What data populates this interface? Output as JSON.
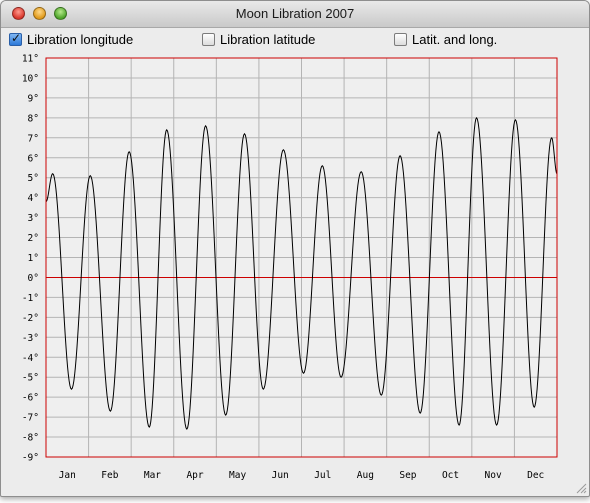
{
  "window": {
    "title": "Moon Libration 2007"
  },
  "checkboxes": [
    {
      "label": "Libration longitude",
      "checked": true
    },
    {
      "label": "Libration latitude",
      "checked": false
    },
    {
      "label": "Latit. and long.",
      "checked": false
    }
  ],
  "chart_data": {
    "type": "line",
    "ylim": [
      -9,
      11
    ],
    "yticks": [
      "11°",
      "10°",
      "9°",
      "8°",
      "7°",
      "6°",
      "5°",
      "4°",
      "3°",
      "2°",
      "1°",
      "0°",
      "-1°",
      "-2°",
      "-3°",
      "-4°",
      "-5°",
      "-6°",
      "-7°",
      "-8°",
      "-9°"
    ],
    "months": [
      "Jan",
      "Feb",
      "Mar",
      "Apr",
      "May",
      "Jun",
      "Jul",
      "Aug",
      "Sep",
      "Oct",
      "Nov",
      "Dec"
    ],
    "grid": true,
    "zero_line": true,
    "colors": {
      "frame": "#cc0000",
      "zero": "#cc0000",
      "grid": "#b4b4b4",
      "line": "#000000"
    },
    "series": [
      {
        "extrema": [
          {
            "day": 0,
            "value": 3.8
          },
          {
            "day": 5,
            "value": 5.2
          },
          {
            "day": 19,
            "value": -5.6
          },
          {
            "day": 33,
            "value": 5.1
          },
          {
            "day": 48,
            "value": -6.7
          },
          {
            "day": 62,
            "value": 6.3
          },
          {
            "day": 77,
            "value": -7.5
          },
          {
            "day": 90,
            "value": 7.4
          },
          {
            "day": 105,
            "value": -7.6
          },
          {
            "day": 119,
            "value": 7.6
          },
          {
            "day": 134,
            "value": -6.9
          },
          {
            "day": 148,
            "value": 7.2
          },
          {
            "day": 162,
            "value": -5.6
          },
          {
            "day": 177,
            "value": 6.4
          },
          {
            "day": 192,
            "value": -4.8
          },
          {
            "day": 206,
            "value": 5.6
          },
          {
            "day": 220,
            "value": -5.0
          },
          {
            "day": 235,
            "value": 5.3
          },
          {
            "day": 250,
            "value": -5.9
          },
          {
            "day": 264,
            "value": 6.1
          },
          {
            "day": 279,
            "value": -6.8
          },
          {
            "day": 293,
            "value": 7.3
          },
          {
            "day": 308,
            "value": -7.4
          },
          {
            "day": 321,
            "value": 8.0
          },
          {
            "day": 336,
            "value": -7.4
          },
          {
            "day": 350,
            "value": 7.9
          },
          {
            "day": 364,
            "value": -6.5
          },
          {
            "day": 377,
            "value": 7.0
          },
          {
            "day": 381,
            "value": 5.2
          }
        ]
      }
    ]
  }
}
